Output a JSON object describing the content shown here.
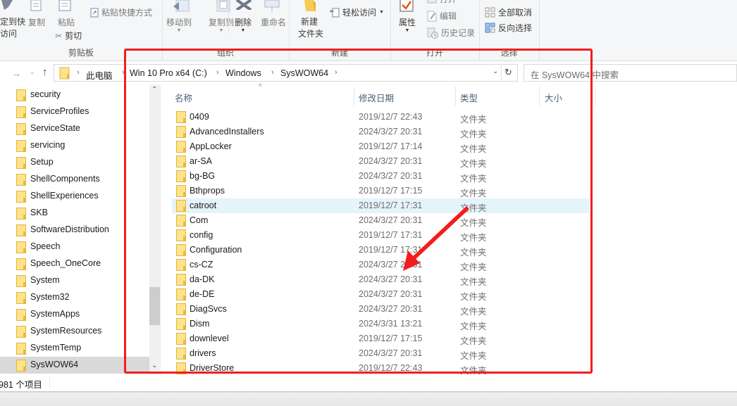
{
  "ribbon": {
    "clipboard": {
      "pin_label_line1": "定到快",
      "pin_label_line2": "访问",
      "copy_label": "复制",
      "paste_label": "粘贴",
      "paste_shortcut_label": "粘贴快捷方式",
      "cut_label": "剪切",
      "group_label": "剪贴板"
    },
    "organize": {
      "move_to_label": "移动到",
      "copy_to_label": "复制到",
      "delete_label": "删除",
      "rename_label": "重命名",
      "group_label": "组织"
    },
    "new": {
      "new_folder_line1": "新建",
      "new_folder_line2": "文件夹",
      "easy_access_label": "轻松访问",
      "group_label": "新建"
    },
    "open": {
      "properties_label": "属性",
      "open_label": "打开",
      "edit_label": "编辑",
      "history_label": "历史记录",
      "group_label": "打开"
    },
    "select": {
      "select_none_label": "全部取消",
      "invert_selection_label": "反向选择",
      "group_label": "选择"
    }
  },
  "address": {
    "crumbs": [
      "此电脑",
      "Win 10 Pro x64 (C:)",
      "Windows",
      "SysWOW64"
    ],
    "search_placeholder": "在 SysWOW64 中搜索"
  },
  "nav": {
    "items": [
      {
        "label": "security"
      },
      {
        "label": "ServiceProfiles"
      },
      {
        "label": "ServiceState"
      },
      {
        "label": "servicing"
      },
      {
        "label": "Setup"
      },
      {
        "label": "ShellComponents"
      },
      {
        "label": "ShellExperiences"
      },
      {
        "label": "SKB"
      },
      {
        "label": "SoftwareDistribution"
      },
      {
        "label": "Speech"
      },
      {
        "label": "Speech_OneCore"
      },
      {
        "label": "System"
      },
      {
        "label": "System32"
      },
      {
        "label": "SystemApps"
      },
      {
        "label": "SystemResources"
      },
      {
        "label": "SystemTemp"
      },
      {
        "label": "SysWOW64",
        "selected": true
      }
    ]
  },
  "list": {
    "columns": {
      "name": "名称",
      "date": "修改日期",
      "type": "类型",
      "size": "大小"
    },
    "rows": [
      {
        "name": "0409",
        "date": "2019/12/7 22:43",
        "type": "文件夹"
      },
      {
        "name": "AdvancedInstallers",
        "date": "2024/3/27 20:31",
        "type": "文件夹"
      },
      {
        "name": "AppLocker",
        "date": "2019/12/7 17:14",
        "type": "文件夹"
      },
      {
        "name": "ar-SA",
        "date": "2024/3/27 20:31",
        "type": "文件夹"
      },
      {
        "name": "bg-BG",
        "date": "2024/3/27 20:31",
        "type": "文件夹"
      },
      {
        "name": "Bthprops",
        "date": "2019/12/7 17:15",
        "type": "文件夹"
      },
      {
        "name": "catroot",
        "date": "2019/12/7 17:31",
        "type": "文件夹",
        "hover": true
      },
      {
        "name": "Com",
        "date": "2024/3/27 20:31",
        "type": "文件夹"
      },
      {
        "name": "config",
        "date": "2019/12/7 17:31",
        "type": "文件夹"
      },
      {
        "name": "Configuration",
        "date": "2019/12/7 17:31",
        "type": "文件夹"
      },
      {
        "name": "cs-CZ",
        "date": "2024/3/27 20:31",
        "type": "文件夹"
      },
      {
        "name": "da-DK",
        "date": "2024/3/27 20:31",
        "type": "文件夹"
      },
      {
        "name": "de-DE",
        "date": "2024/3/27 20:31",
        "type": "文件夹"
      },
      {
        "name": "DiagSvcs",
        "date": "2024/3/27 20:31",
        "type": "文件夹"
      },
      {
        "name": "Dism",
        "date": "2024/3/31 13:21",
        "type": "文件夹"
      },
      {
        "name": "downlevel",
        "date": "2019/12/7 17:15",
        "type": "文件夹"
      },
      {
        "name": "drivers",
        "date": "2024/3/27 20:31",
        "type": "文件夹"
      },
      {
        "name": "DriverStore",
        "date": "2019/12/7 22:43",
        "type": "文件夹"
      }
    ]
  },
  "status": {
    "item_count": "981 个项目"
  },
  "annotation": {
    "color": "#f41c1c"
  }
}
